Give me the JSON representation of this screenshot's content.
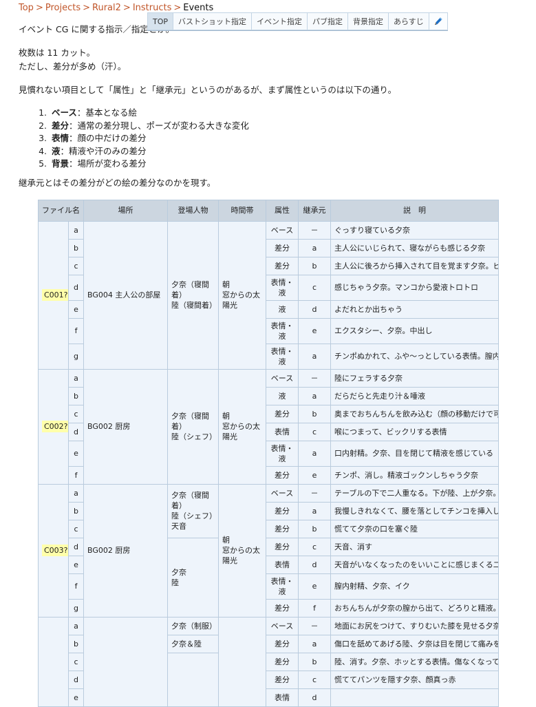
{
  "breadcrumb": {
    "items": [
      "Top",
      "Projects",
      "Rural2",
      "Instructs"
    ],
    "current": "Events",
    "separator": ">"
  },
  "tabs": [
    {
      "label": "TOP",
      "active": true
    },
    {
      "label": "バストショット指定",
      "active": false
    },
    {
      "label": "イベント指定",
      "active": false
    },
    {
      "label": "パブ指定",
      "active": false
    },
    {
      "label": "背景指定",
      "active": false
    },
    {
      "label": "あらすじ",
      "active": false
    },
    {
      "label": "",
      "active": false,
      "icon": "pencil-icon"
    }
  ],
  "body": {
    "intro": "イベント CG に関する指示／指定とか。",
    "count_line_1": "枚数は 11 カット。",
    "count_line_2": "ただし、差分が多め（汗）。",
    "attr_intro": "見慣れない項目として「属性」と「継承元」というのがあるが、まず属性というのは以下の通り。",
    "attr_list": [
      {
        "term": "ベース",
        "desc": "：基本となる絵"
      },
      {
        "term": "差分",
        "desc": "：通常の差分現し、ポーズが変わる大きな変化"
      },
      {
        "term": "表情",
        "desc": "：顔の中だけの差分"
      },
      {
        "term": "液",
        "desc": "：精液や汗のみの差分"
      },
      {
        "term": "背景",
        "desc": "：場所が変わる差分"
      }
    ],
    "source_note": "継承元とはその差分がどの絵の差分なのかを現す。"
  },
  "table": {
    "headers": [
      "ファイル名",
      "場所",
      "登場人物",
      "時間帯",
      "属性",
      "継承元",
      "説　明"
    ],
    "groups": [
      {
        "file": "C001?",
        "place": "BG004 主人公の部屋",
        "chars": [
          "夕奈（寝間着）",
          "陸（寝間着）"
        ],
        "time": [
          "朝",
          "窓からの太陽光"
        ],
        "rows": [
          {
            "idx": "a",
            "attr": "ベース",
            "src": "－",
            "desc": "ぐっすり寝ている夕奈"
          },
          {
            "idx": "b",
            "attr": "差分",
            "src": "a",
            "desc": "主人公にいじられて、寝ながらも感じる夕奈"
          },
          {
            "idx": "c",
            "attr": "差分",
            "src": "b",
            "desc": "主人公に後ろから挿入されて目を覚ます夕奈。ビックリ表情"
          },
          {
            "idx": "d",
            "attr": "表情・液",
            "src": "c",
            "desc": "感じちゃう夕奈。マンコから愛液トロトロ"
          },
          {
            "idx": "e",
            "attr": "液",
            "src": "d",
            "desc": "よだれとか出ちゃう"
          },
          {
            "idx": "f",
            "attr": "表情・液",
            "src": "e",
            "desc": "エクスタシー、夕奈。中出し"
          },
          {
            "idx": "g",
            "attr": "表情・液",
            "src": "a",
            "desc": "チンポぬかれて、ふや～っとしている表情。膣内から精液漏れる"
          }
        ]
      },
      {
        "file": "C002?",
        "place": "BG002 厨房",
        "chars": [
          "夕奈（寝間着）",
          "陸（シェフ）"
        ],
        "time": [
          "朝",
          "窓からの太陽光"
        ],
        "rows": [
          {
            "idx": "a",
            "attr": "ベース",
            "src": "－",
            "desc": "陸にフェラする夕奈"
          },
          {
            "idx": "b",
            "attr": "液",
            "src": "a",
            "desc": "だらだらと先走り汁＆唾液"
          },
          {
            "idx": "c",
            "attr": "差分",
            "src": "b",
            "desc": "奥までおちんちんを飲み込む（顔の移動だけで可？"
          },
          {
            "idx": "d",
            "attr": "表情",
            "src": "c",
            "desc": "喉につまって、ビックリする表情"
          },
          {
            "idx": "e",
            "attr": "表情・液",
            "src": "a",
            "desc": "口内射精。夕奈、目を閉じて精液を感じている"
          },
          {
            "idx": "f",
            "attr": "差分",
            "src": "e",
            "desc": "チンポ、消し。精液ゴックンしちゃう夕奈"
          }
        ]
      },
      {
        "file": "C003?",
        "place": "BG002 厨房",
        "chars_split": [
          {
            "lines": [
              "夕奈（寝間着）",
              "陸（シェフ）",
              "天音"
            ],
            "span": 3
          },
          {
            "lines": [
              "夕奈",
              "陸"
            ],
            "span": 4
          }
        ],
        "time": [
          "朝",
          "窓からの太陽光"
        ],
        "rows": [
          {
            "idx": "a",
            "attr": "ベース",
            "src": "－",
            "desc": "テーブルの下で二人重なる。下が陸、上が夕奈。向こうに天音の足"
          },
          {
            "idx": "b",
            "attr": "差分",
            "src": "a",
            "desc": "我慢しきれなくて、腰を落としてチンコを挿入してしまう夕奈"
          },
          {
            "idx": "c",
            "attr": "差分",
            "src": "b",
            "desc": "慌てて夕奈の口を塞ぐ陸"
          },
          {
            "idx": "d",
            "attr": "差分",
            "src": "c",
            "desc": "天音、消す"
          },
          {
            "idx": "e",
            "attr": "表情",
            "src": "d",
            "desc": "天音がいなくなったのをいいことに感じまくる二人"
          },
          {
            "idx": "f",
            "attr": "表情・液",
            "src": "e",
            "desc": "膣内射精、夕奈、イク"
          },
          {
            "idx": "g",
            "attr": "差分",
            "src": "f",
            "desc": "おちんちんが夕奈の膣から出て、どろりと精液。夕奈惚け"
          }
        ]
      },
      {
        "file": "",
        "place": "",
        "chars_split": [
          {
            "lines": [
              "夕奈（制服）"
            ],
            "span": 1
          },
          {
            "lines": [
              "夕奈＆陸"
            ],
            "span": 1
          },
          {
            "lines": [
              ""
            ],
            "span": 3
          }
        ],
        "time": [
          ""
        ],
        "rows": [
          {
            "idx": "a",
            "attr": "ベース",
            "src": "－",
            "desc": "地面にお尻をつけて、すりむいた膝を見せる夕奈。パンツ丸見え"
          },
          {
            "idx": "b",
            "attr": "差分",
            "src": "a",
            "desc": "傷口を舐めてあげる陸、夕奈は目を閉じて痛みを耐える"
          },
          {
            "idx": "c",
            "attr": "差分",
            "src": "b",
            "desc": "陸、消す。夕奈、ホッとする表情。傷なくなっている"
          },
          {
            "idx": "d",
            "attr": "差分",
            "src": "c",
            "desc": "慌ててパンツを隠す夕奈、顔真っ赤"
          },
          {
            "idx": "e",
            "attr": "表情",
            "src": "d",
            "desc": ""
          }
        ]
      }
    ]
  }
}
